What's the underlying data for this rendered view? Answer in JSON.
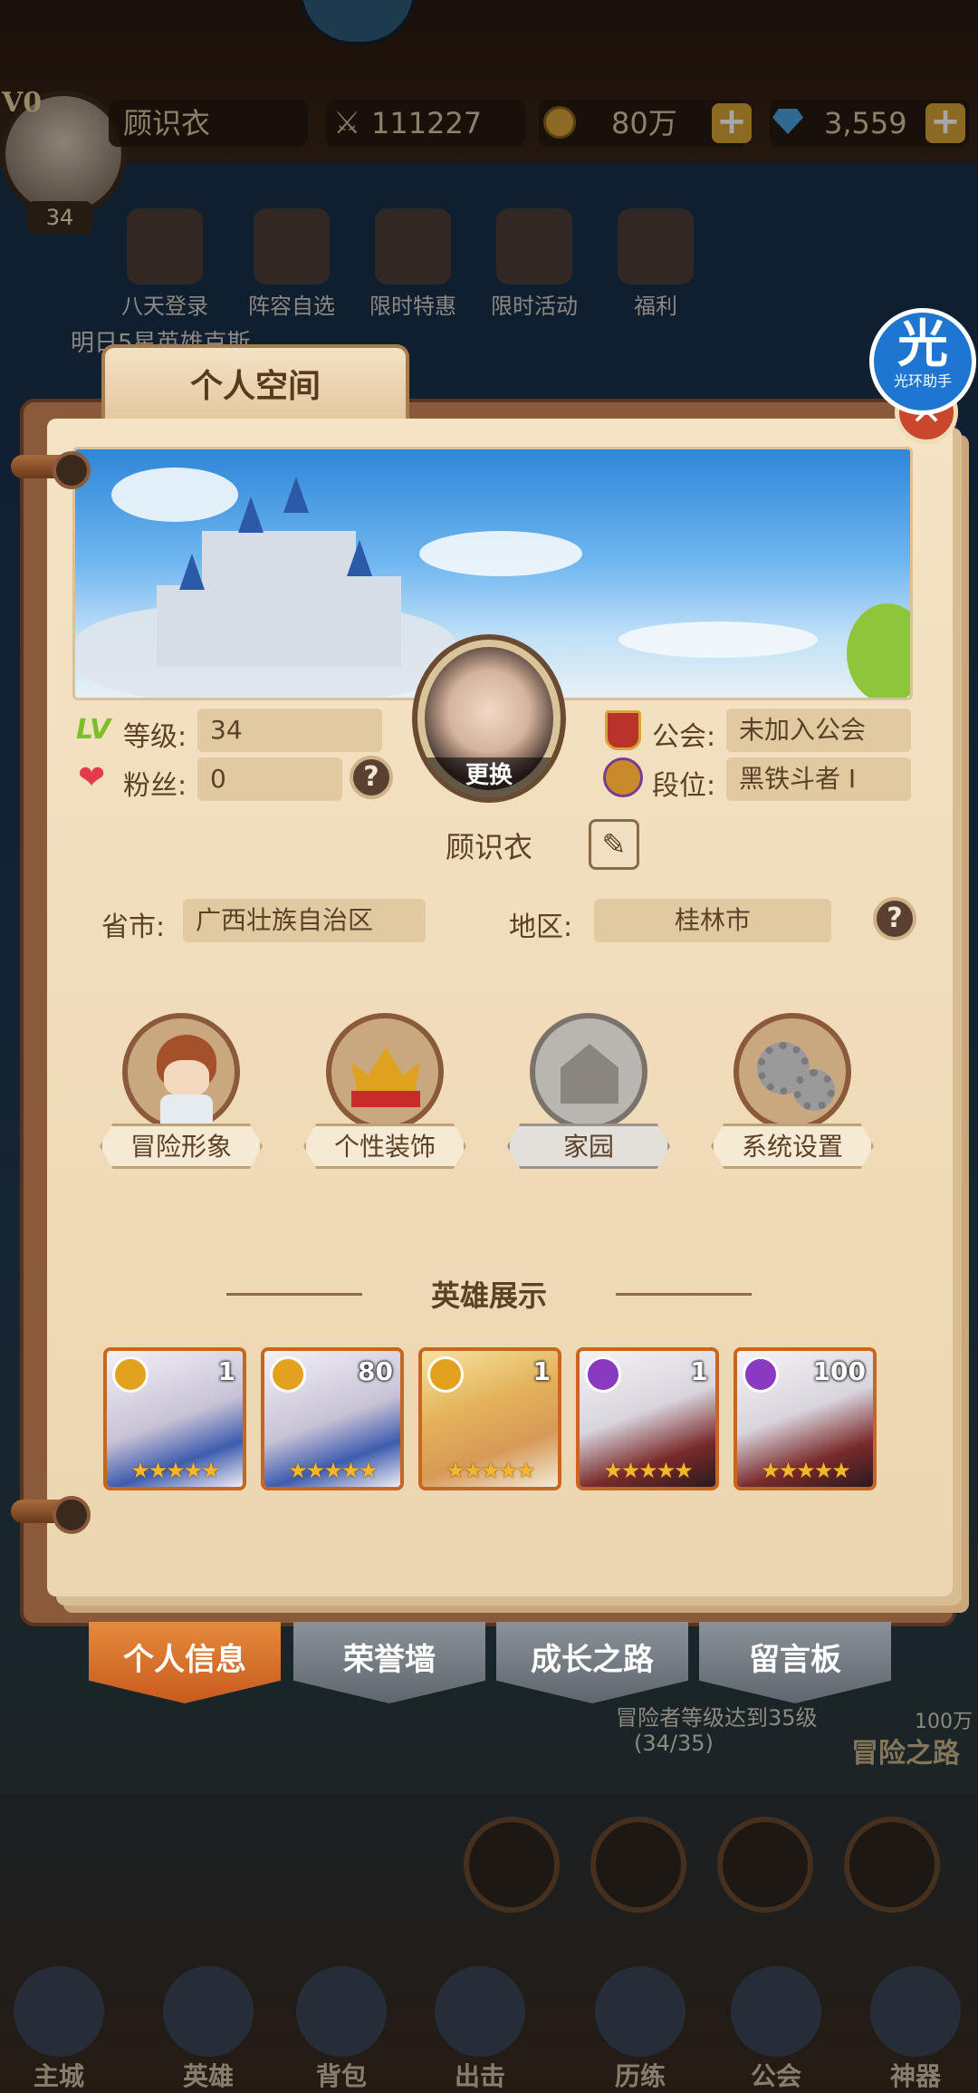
{
  "top_bar": {
    "vip": "V0",
    "player_name": "顾识衣",
    "level": "34",
    "power": "111227",
    "gold": "80万",
    "gems": "3,559",
    "plus": "+"
  },
  "events": [
    {
      "label": "八天登录"
    },
    {
      "label": "阵容自选"
    },
    {
      "label": "限时特惠"
    },
    {
      "label": "限时活动"
    },
    {
      "label": "福利"
    }
  ],
  "event_marquee": "明日5星英雄克斯",
  "helper": {
    "big": "光",
    "small": "光环助手"
  },
  "panel": {
    "title": "个人空间",
    "close": "×",
    "avatar_change": "更换",
    "level_icon": "LV",
    "level_label": "等级:",
    "level_value": "34",
    "fans_label": "粉丝:",
    "fans_value": "0",
    "guild_label": "公会:",
    "guild_value": "未加入公会",
    "rank_label": "段位:",
    "rank_value": "黑铁斗者 I",
    "help": "?",
    "name": "顾识衣",
    "province_label": "省市:",
    "province_value": "广西壮族自治区",
    "region_label": "地区:",
    "region_value": "桂林市",
    "menu": [
      {
        "label": "冒险形象"
      },
      {
        "label": "个性装饰"
      },
      {
        "label": "家园"
      },
      {
        "label": "系统设置"
      }
    ],
    "hero_section_title": "英雄展示",
    "heroes": [
      {
        "level": "1",
        "stars": "★★★★★",
        "element": "sun"
      },
      {
        "level": "80",
        "stars": "★★★★★",
        "element": "sun"
      },
      {
        "level": "1",
        "stars": "★★★★★",
        "element": "sun"
      },
      {
        "level": "1",
        "stars": "★★★★★",
        "element": "dark"
      },
      {
        "level": "100",
        "stars": "★★★★★",
        "element": "dark"
      }
    ]
  },
  "tabs": [
    {
      "label": "个人信息",
      "active": true
    },
    {
      "label": "荣誉墙",
      "active": false
    },
    {
      "label": "成长之路",
      "active": false
    },
    {
      "label": "留言板",
      "active": false
    }
  ],
  "quest": {
    "text": "冒险者等级达到35级",
    "progress": "(34/35)",
    "reward": "100万",
    "title": "冒险之路"
  },
  "bottom_nav": [
    {
      "label": "主城"
    },
    {
      "label": "英雄"
    },
    {
      "label": "背包"
    },
    {
      "label": "出击"
    },
    {
      "label": "历练"
    },
    {
      "label": "公会"
    },
    {
      "label": "神器"
    }
  ],
  "colors": {
    "accent_orange": "#c85a1e",
    "paper": "#f4e3c5",
    "frame_brown": "#8a5a3b",
    "sun_element": "#e3a21e",
    "dark_element": "#8a3ac0"
  }
}
